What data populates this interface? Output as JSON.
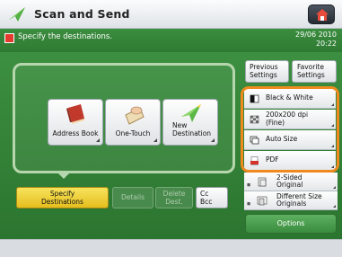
{
  "titlebar": {
    "title": "Scan and Send",
    "icon": "paper-plane-icon",
    "home_icon": "home-icon"
  },
  "status": {
    "message": "Specify the destinations.",
    "date": "29/06 2010",
    "time": "20:22",
    "icon": "warning-icon"
  },
  "destinations": {
    "buttons": [
      {
        "label": "Address Book",
        "icon": "address-book-icon"
      },
      {
        "label": "One-Touch",
        "icon": "one-touch-icon"
      },
      {
        "label_line1": "New",
        "label_line2": "Destination",
        "icon": "new-destination-icon"
      }
    ]
  },
  "tabs": {
    "specify_line1": "Specify",
    "specify_line2": "Destinations",
    "details": "Details",
    "delete_line1": "Delete",
    "delete_line2": "Dest.",
    "cc_line1": "Cc",
    "cc_line2": "Bcc"
  },
  "top_settings": {
    "previous_line1": "Previous",
    "previous_line2": "Settings",
    "favorite_line1": "Favorite",
    "favorite_line2": "Settings"
  },
  "settings": [
    {
      "label_line1": "Black & White",
      "label_line2": "",
      "icon": "black-white-icon"
    },
    {
      "label_line1": "200x200 dpi",
      "label_line2": "(Fine)",
      "icon": "resolution-icon"
    },
    {
      "label_line1": "Auto Size",
      "label_line2": "",
      "icon": "auto-size-icon"
    },
    {
      "label_line1": "PDF",
      "label_line2": "",
      "icon": "pdf-icon"
    }
  ],
  "lower_settings": [
    {
      "label_line1": "2-Sided",
      "label_line2": "Original",
      "icon": "two-sided-icon"
    },
    {
      "label_line1": "Different Size",
      "label_line2": "Originals",
      "icon": "different-size-icon"
    }
  ],
  "options_label": "Options",
  "colors": {
    "green": "#3c8f40",
    "highlight": "#ef8a1f",
    "specify": "#f2d53a"
  }
}
